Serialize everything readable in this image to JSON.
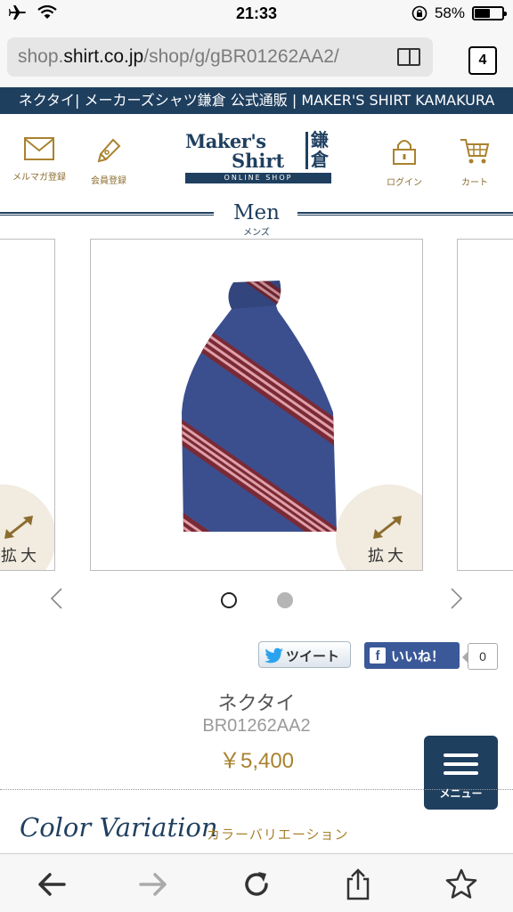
{
  "status_bar": {
    "time": "21:33",
    "battery": "58%",
    "battery_level": 0.58,
    "icons": [
      "airplane-icon",
      "wifi-icon",
      "orientation-lock-icon",
      "battery-icon"
    ]
  },
  "browser": {
    "url_prefix": "shop.",
    "url_domain": "shirt.co.jp",
    "url_path": "/shop/g/gBR01262AA2/",
    "tab_count": "4"
  },
  "site": {
    "banner": "ネクタイ| メーカーズシャツ鎌倉 公式通販 | MAKER'S SHIRT KAMAKURA",
    "brand_color": "#1f3f5f",
    "gold_color": "#a9822f",
    "logo": {
      "line1": "Maker's",
      "line2": "Shirt",
      "kanji1": "鎌",
      "kanji2": "倉",
      "subtitle": "ONLINE SHOP"
    },
    "nav": {
      "newsletter": "メルマガ登録",
      "member": "会員登録",
      "login": "ログイン",
      "cart": "カート"
    }
  },
  "section": {
    "title": "Men",
    "subtitle": "メンズ"
  },
  "gallery": {
    "zoom_label": "拡大",
    "current_slide": 1,
    "slide_count": 2
  },
  "social": {
    "tweet_label": "ツイート",
    "like_label": "いいね！",
    "like_count": "0"
  },
  "product": {
    "name": "ネクタイ",
    "code": "BR01262AA2",
    "price": "￥5,400"
  },
  "menu": {
    "label": "メニュー"
  },
  "color_variation": {
    "title": "Color Variation",
    "subtitle": "カラーバリエーション"
  }
}
